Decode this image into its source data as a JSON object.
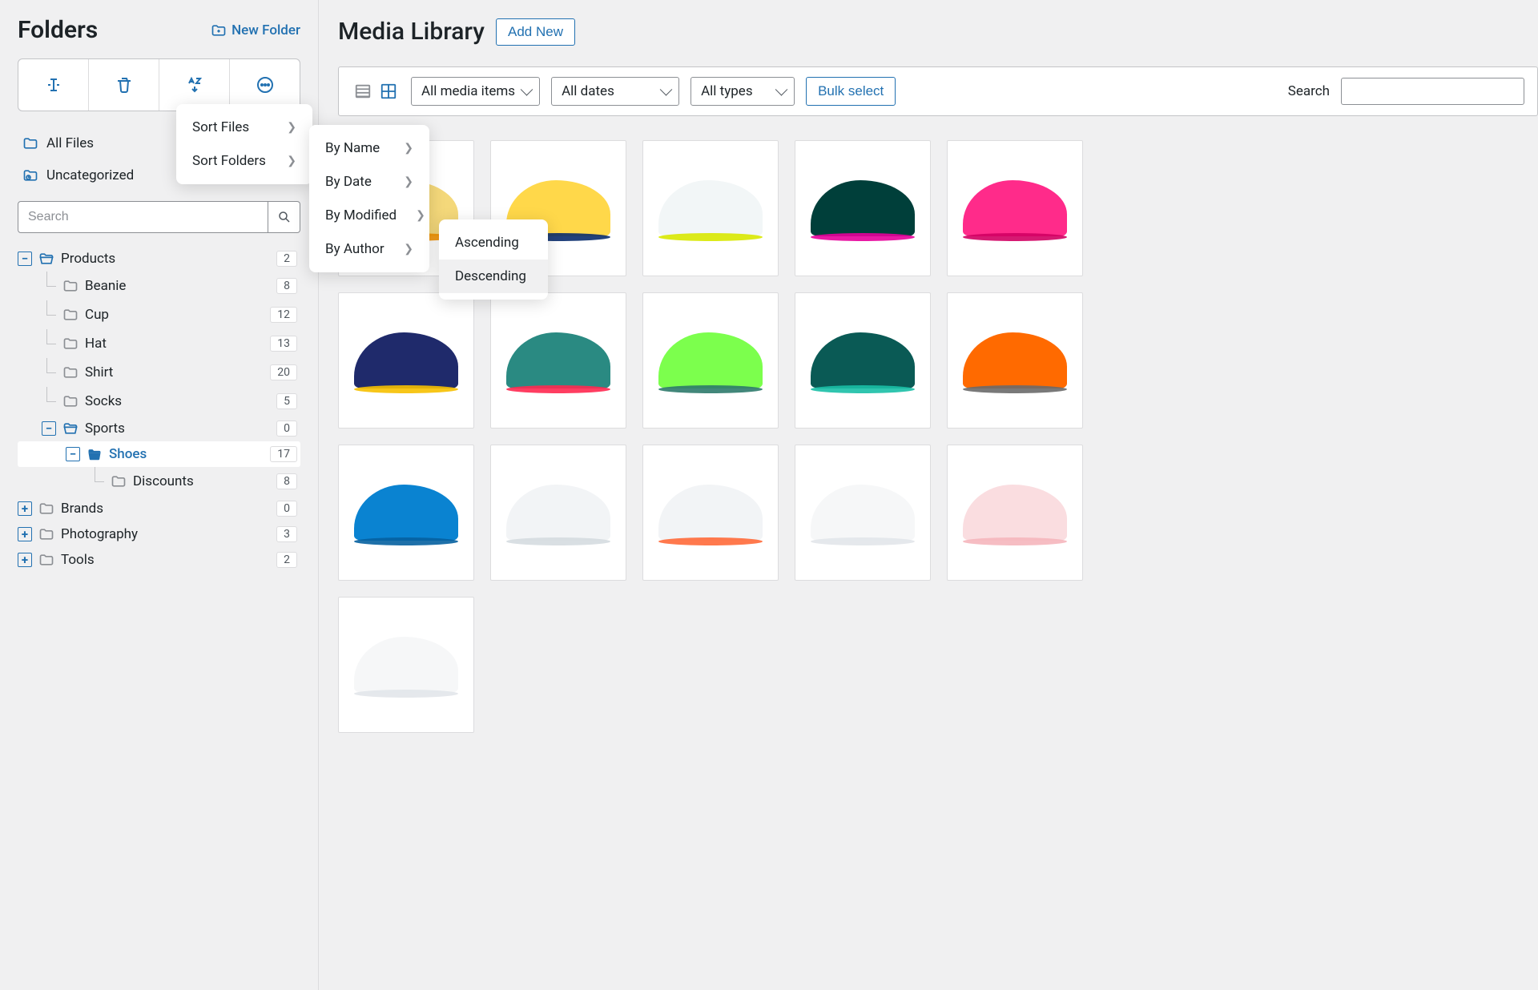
{
  "sidebar": {
    "title": "Folders",
    "new_folder_label": "New Folder",
    "search_placeholder": "Search",
    "quick_links": {
      "all_files": "All Files",
      "uncategorized": "Uncategorized"
    }
  },
  "tree": [
    {
      "label": "Products",
      "count": "2",
      "depth": 0,
      "toggle": "-",
      "icon": "active-open",
      "selected": false
    },
    {
      "label": "Beanie",
      "count": "8",
      "depth": 1,
      "toggle": "",
      "icon": "tinted",
      "selected": false,
      "branch": true
    },
    {
      "label": "Cup",
      "count": "12",
      "depth": 1,
      "toggle": "",
      "icon": "tinted",
      "selected": false,
      "branch": true
    },
    {
      "label": "Hat",
      "count": "13",
      "depth": 1,
      "toggle": "",
      "icon": "tinted",
      "selected": false,
      "branch": true
    },
    {
      "label": "Shirt",
      "count": "20",
      "depth": 1,
      "toggle": "",
      "icon": "tinted",
      "selected": false,
      "branch": true
    },
    {
      "label": "Socks",
      "count": "5",
      "depth": 1,
      "toggle": "",
      "icon": "tinted",
      "selected": false,
      "branch": true
    },
    {
      "label": "Sports",
      "count": "0",
      "depth": 1,
      "toggle": "-",
      "icon": "active-open",
      "selected": false
    },
    {
      "label": "Shoes",
      "count": "17",
      "depth": 2,
      "toggle": "-",
      "icon": "solid",
      "selected": true
    },
    {
      "label": "Discounts",
      "count": "8",
      "depth": 3,
      "toggle": "",
      "icon": "tinted",
      "selected": false,
      "branch": true
    },
    {
      "label": "Brands",
      "count": "0",
      "depth": 0,
      "toggle": "+",
      "icon": "tinted",
      "selected": false
    },
    {
      "label": "Photography",
      "count": "3",
      "depth": 0,
      "toggle": "+",
      "icon": "tinted",
      "selected": false
    },
    {
      "label": "Tools",
      "count": "2",
      "depth": 0,
      "toggle": "+",
      "icon": "tinted",
      "selected": false
    }
  ],
  "main": {
    "title": "Media Library",
    "add_new_label": "Add New",
    "filters": {
      "media_items": "All media items",
      "dates": "All dates",
      "types": "All types",
      "bulk_select": "Bulk select",
      "search_label": "Search"
    }
  },
  "menus": {
    "sort": [
      {
        "label": "Sort Files",
        "arrow": true
      },
      {
        "label": "Sort Folders",
        "arrow": true
      }
    ],
    "by": [
      {
        "label": "By Name",
        "arrow": true
      },
      {
        "label": "By Date",
        "arrow": true
      },
      {
        "label": "By Modified",
        "arrow": true
      },
      {
        "label": "By Author",
        "arrow": true
      }
    ],
    "order": [
      {
        "label": "Ascending",
        "hover": false
      },
      {
        "label": "Descending",
        "hover": true
      }
    ]
  },
  "media": [
    {
      "bg": "#f4d87a",
      "sole": "#f49300"
    },
    {
      "bg": "#ffd84a",
      "sole": "#0a2e6e"
    },
    {
      "bg": "#f2f6f7",
      "sole": "#d8e800"
    },
    {
      "bg": "#003f3a",
      "sole": "#e5009a"
    },
    {
      "bg": "#ff2b8a",
      "sole": "#d10063"
    },
    {
      "bg": "#1f2a6b",
      "sole": "#f6c000"
    },
    {
      "bg": "#2a8a82",
      "sole": "#ff2850"
    },
    {
      "bg": "#7cff4d",
      "sole": "#2e7a6b"
    },
    {
      "bg": "#0a5a55",
      "sole": "#1abfa6"
    },
    {
      "bg": "#ff6a00",
      "sole": "#6a6a6a"
    },
    {
      "bg": "#0a83d1",
      "sole": "#0660a0"
    },
    {
      "bg": "#f2f4f6",
      "sole": "#d5dbe0"
    },
    {
      "bg": "#f2f4f6",
      "sole": "#ff6a3a"
    },
    {
      "bg": "#f6f7f8",
      "sole": "#e2e6ea"
    },
    {
      "bg": "#fadde0",
      "sole": "#f5b6bd"
    },
    {
      "bg": "#f6f7f8",
      "sole": "#e2e6ea"
    }
  ]
}
